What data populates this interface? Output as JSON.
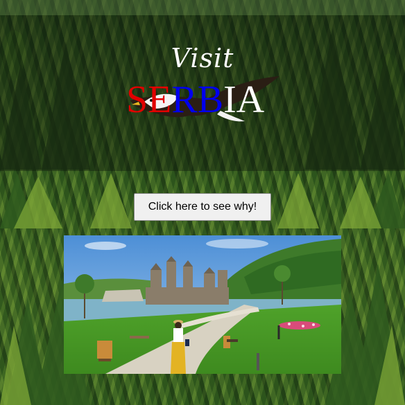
{
  "header": {
    "visit_label": "Visit",
    "country_letters": [
      {
        "char": "S",
        "color": "#e10000"
      },
      {
        "char": "E",
        "color": "#e10000"
      },
      {
        "char": "R",
        "color": "#0000ee"
      },
      {
        "char": "B",
        "color": "#0000ee"
      },
      {
        "char": "I",
        "color": "#ffffff"
      },
      {
        "char": "A",
        "color": "#ffffff"
      }
    ]
  },
  "cta": {
    "label": "Click here to see why!"
  },
  "photo": {
    "subject": "fortress-landscape"
  },
  "colors": {
    "forest_dark": "#2e4a22",
    "forest_light": "#8bb43a",
    "sky": "#6aa6dc",
    "river": "#7fb3c8",
    "grass": "#4fa22a"
  }
}
